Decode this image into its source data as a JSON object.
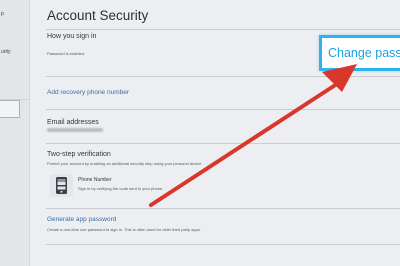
{
  "sidebar": {
    "items": [
      {
        "label": "p"
      },
      {
        "label": "urity"
      }
    ]
  },
  "page": {
    "title": "Account Security"
  },
  "sign_in": {
    "heading": "How you sign in",
    "password_status": "Password is enabled.",
    "change_password_label": "Change pass"
  },
  "recovery": {
    "link_label": "Add recovery phone number"
  },
  "email": {
    "heading": "Email addresses"
  },
  "two_step": {
    "heading": "Two-step verification",
    "description": "Protect your account by enabling an additional security step using your personal device.",
    "phone": {
      "label": "Phone Number",
      "description": "Sign in by verifying the code sent to your phone."
    }
  },
  "app_password": {
    "link_label": "Generate app password",
    "description": "Create a one-time use password to sign in. This is often used for older third party apps."
  },
  "colors": {
    "background": "#eceef1",
    "link": "#3a6fa8",
    "highlight_border": "#2fb4e9",
    "highlight_text": "#1f9fe0",
    "arrow": "#d9362c"
  },
  "icons": {
    "phone": "mobile-phone-icon",
    "arrow": "red-pointer-arrow"
  }
}
